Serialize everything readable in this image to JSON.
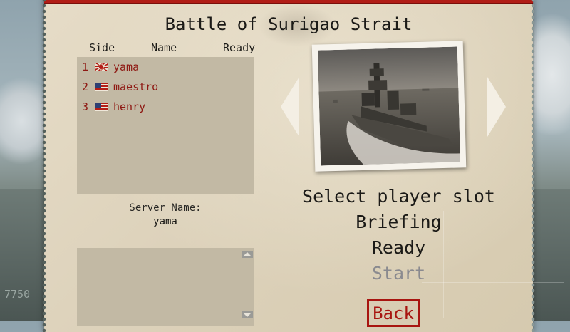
{
  "scenario": {
    "title": "Battle of Surigao Strait"
  },
  "player_table": {
    "headers": {
      "side": "Side",
      "name": "Name",
      "ready": "Ready"
    },
    "players": [
      {
        "num": "1",
        "flag": "japan-flag-icon",
        "name": "yama"
      },
      {
        "num": "2",
        "flag": "usa-flag-icon",
        "name": "maestro"
      },
      {
        "num": "3",
        "flag": "usa-flag-icon",
        "name": "henry"
      }
    ]
  },
  "server": {
    "label": "Server Name:",
    "value": "yama"
  },
  "menu": {
    "select_slot": "Select player slot",
    "briefing": "Briefing",
    "ready": "Ready",
    "start": "Start",
    "back": "Back"
  },
  "background": {
    "readout": "7750"
  },
  "colors": {
    "accent_red": "#a81510",
    "paper": "#ddd2bb",
    "disabled": "#8a8a8f"
  }
}
